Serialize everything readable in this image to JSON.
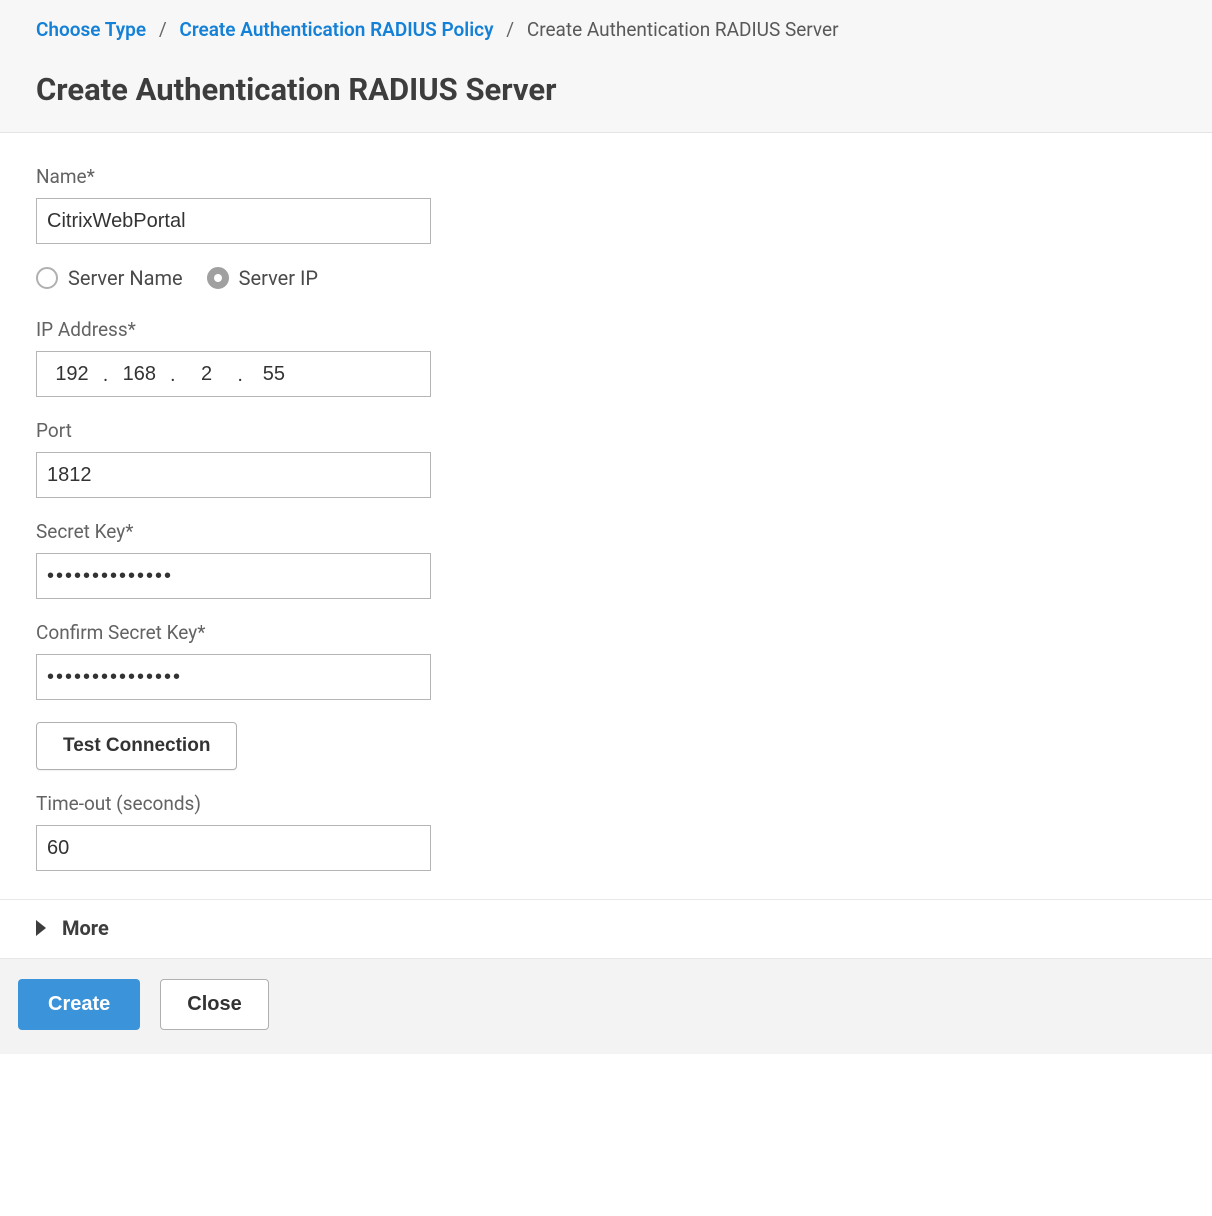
{
  "breadcrumb": {
    "items": [
      {
        "label": "Choose Type",
        "link": true
      },
      {
        "label": "Create Authentication RADIUS Policy",
        "link": true
      },
      {
        "label": "Create Authentication RADIUS Server",
        "link": false
      }
    ]
  },
  "page_title": "Create Authentication RADIUS Server",
  "form": {
    "name_label": "Name*",
    "name_value": "CitrixWebPortal",
    "radio_server_name": "Server Name",
    "radio_server_ip": "Server IP",
    "radio_selected": "ip",
    "ip_label": "IP Address*",
    "ip_octets": [
      "192",
      "168",
      "2",
      "55"
    ],
    "port_label": "Port",
    "port_value": "1812",
    "secret_label": "Secret Key*",
    "secret_value": "••••••••••••••",
    "confirm_label": "Confirm Secret Key*",
    "confirm_value": "•••••••••••••••",
    "test_button": "Test Connection",
    "timeout_label": "Time-out (seconds)",
    "timeout_value": "60"
  },
  "more_label": "More",
  "footer": {
    "create_label": "Create",
    "close_label": "Close"
  }
}
